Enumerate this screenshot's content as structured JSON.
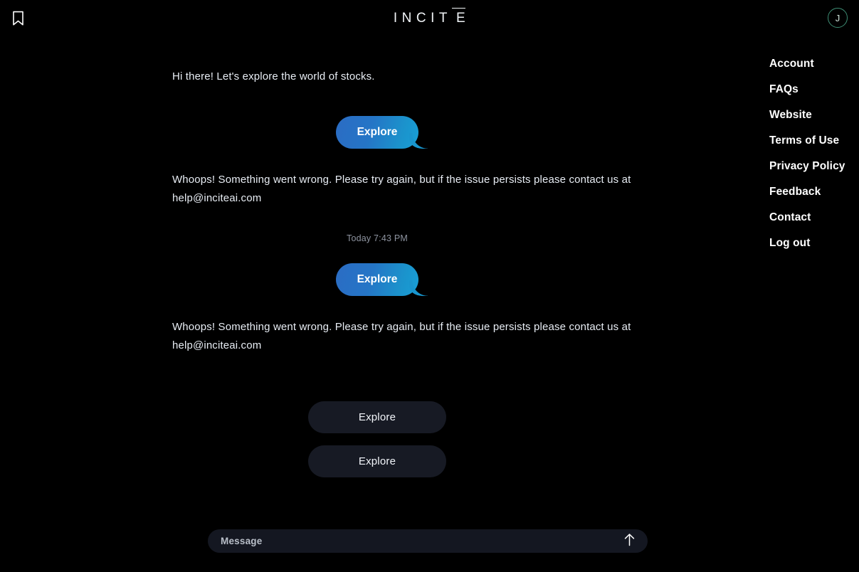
{
  "app": {
    "brand_prefix": "INCIT",
    "brand_suffix": "E",
    "background_color": "#000000"
  },
  "topbar": {
    "bookmark_icon": "bookmark-icon",
    "avatar_initial": "J",
    "avatar_ring_color": "#3e8d74"
  },
  "menu": {
    "items": [
      {
        "label": "Account"
      },
      {
        "label": "FAQs"
      },
      {
        "label": "Website"
      },
      {
        "label": "Terms of Use"
      },
      {
        "label": "Privacy Policy"
      },
      {
        "label": "Feedback"
      },
      {
        "label": "Contact"
      },
      {
        "label": "Log out"
      }
    ]
  },
  "conversation": {
    "greeting": "Hi there! Let's explore the world of stocks.",
    "bubble_one_label": "Explore",
    "error_one": "Whoops! Something went wrong. Please try again, but if the issue persists please contact us at help@inciteai.com",
    "timestamp": "Today 7:43 PM",
    "bubble_two_label": "Explore",
    "error_two": "Whoops! Something went wrong. Please try again, but if the issue persists please contact us at help@inciteai.com",
    "bubble_accent_start": "#2b6cc4",
    "bubble_accent_end": "#189fd6",
    "support_email": "help@inciteai.com"
  },
  "actions": {
    "explore_one": "Explore",
    "explore_two": "Explore",
    "pill_background": "#171a24"
  },
  "composer": {
    "placeholder": "Message",
    "value": "",
    "send_icon": "arrow-up-icon"
  }
}
